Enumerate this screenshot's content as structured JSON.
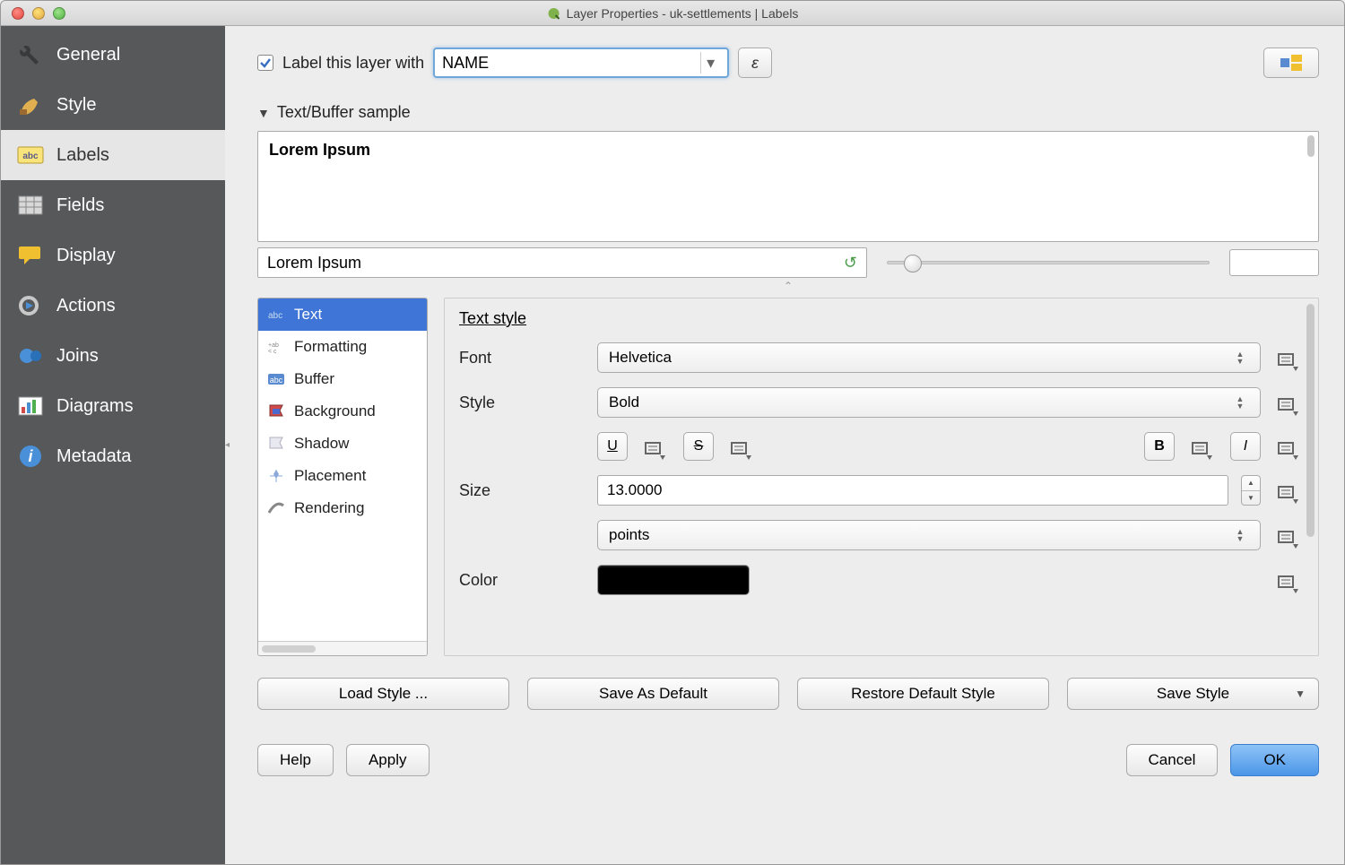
{
  "window": {
    "title": "Layer Properties - uk-settlements | Labels"
  },
  "sidebar": {
    "items": [
      {
        "label": "General"
      },
      {
        "label": "Style"
      },
      {
        "label": "Labels"
      },
      {
        "label": "Fields"
      },
      {
        "label": "Display"
      },
      {
        "label": "Actions"
      },
      {
        "label": "Joins"
      },
      {
        "label": "Diagrams"
      },
      {
        "label": "Metadata"
      }
    ]
  },
  "header": {
    "checkbox_label": "Label this layer with",
    "field_value": "NAME",
    "expr_btn": "ε"
  },
  "sample": {
    "section": "Text/Buffer sample",
    "preview": "Lorem Ipsum",
    "input": "Lorem Ipsum"
  },
  "tabs": [
    {
      "label": "Text"
    },
    {
      "label": "Formatting"
    },
    {
      "label": "Buffer"
    },
    {
      "label": "Background"
    },
    {
      "label": "Shadow"
    },
    {
      "label": "Placement"
    },
    {
      "label": "Rendering"
    }
  ],
  "text_style": {
    "heading": "Text style",
    "font_label": "Font",
    "font_value": "Helvetica",
    "style_label": "Style",
    "style_value": "Bold",
    "underline": "U",
    "strike": "S",
    "bold": "B",
    "italic": "I",
    "size_label": "Size",
    "size_value": "13.0000",
    "unit_value": "points",
    "color_label": "Color",
    "color_value": "#000000"
  },
  "bottom": {
    "load": "Load Style ...",
    "save_default": "Save As Default",
    "restore": "Restore Default Style",
    "save_style": "Save Style"
  },
  "footer": {
    "help": "Help",
    "apply": "Apply",
    "cancel": "Cancel",
    "ok": "OK"
  }
}
